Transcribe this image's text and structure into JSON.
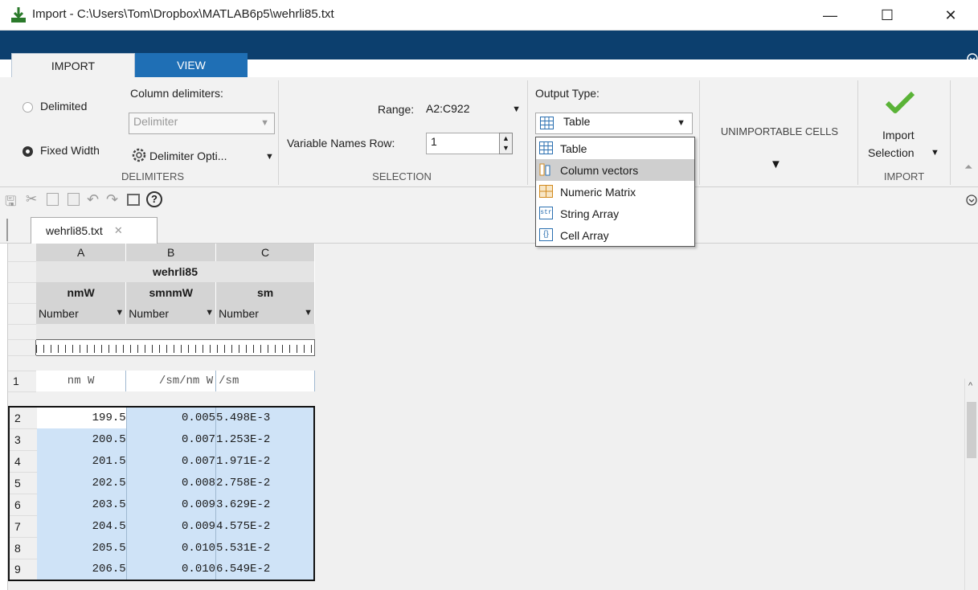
{
  "window": {
    "title": "Import - C:\\Users\\Tom\\Dropbox\\MATLAB6p5\\wehrli85.txt",
    "min": "—",
    "max": "☐",
    "close": "✕"
  },
  "tabs": {
    "import": "IMPORT",
    "view": "VIEW"
  },
  "delimiters": {
    "delimited": "Delimited",
    "fixed_width": "Fixed Width",
    "column_delimiters_label": "Column delimiters:",
    "delimiter_placeholder": "Delimiter",
    "delimiter_options": "Delimiter Opti...",
    "group_label": "DELIMITERS"
  },
  "selection": {
    "range_label": "Range:",
    "range_value": "A2:C922",
    "varnames_label": "Variable Names Row:",
    "varnames_value": "1",
    "group_label": "SELECTION"
  },
  "output": {
    "label": "Output Type:",
    "selected": "Table",
    "options": [
      "Table",
      "Column vectors",
      "Numeric Matrix",
      "String Array",
      "Cell Array"
    ],
    "highlighted": "Column vectors"
  },
  "unimportable": {
    "label": "UNIMPORTABLE CELLS"
  },
  "import": {
    "button_line1": "Import",
    "button_line2": "Selection",
    "group_label": "IMPORT"
  },
  "file_tab": {
    "name": "wehrli85.txt",
    "close": "✕"
  },
  "grid": {
    "col_letters": [
      "A",
      "B",
      "C"
    ],
    "table_name": "wehrli85",
    "var_names": [
      "nmW",
      "smnmW",
      "sm"
    ],
    "types": [
      "Number",
      "Number",
      "Number"
    ],
    "row1": [
      "nm  W",
      "/sm/nm   W",
      "/sm"
    ],
    "row_numbers": [
      "1",
      "2",
      "3",
      "4",
      "5",
      "6",
      "7",
      "8",
      "9"
    ],
    "rows": [
      [
        "199.5",
        "0.005",
        "5.498E-3"
      ],
      [
        "200.5",
        "0.007",
        "1.253E-2"
      ],
      [
        "201.5",
        "0.007",
        "1.971E-2"
      ],
      [
        "202.5",
        "0.008",
        "2.758E-2"
      ],
      [
        "203.5",
        "0.009",
        "3.629E-2"
      ],
      [
        "204.5",
        "0.009",
        "4.575E-2"
      ],
      [
        "205.5",
        "0.010",
        "5.531E-2"
      ],
      [
        "206.5",
        "0.010",
        "6.549E-2"
      ]
    ]
  },
  "icons": {
    "help": "?",
    "checkmark": "✔",
    "arrow_down": "▼"
  }
}
